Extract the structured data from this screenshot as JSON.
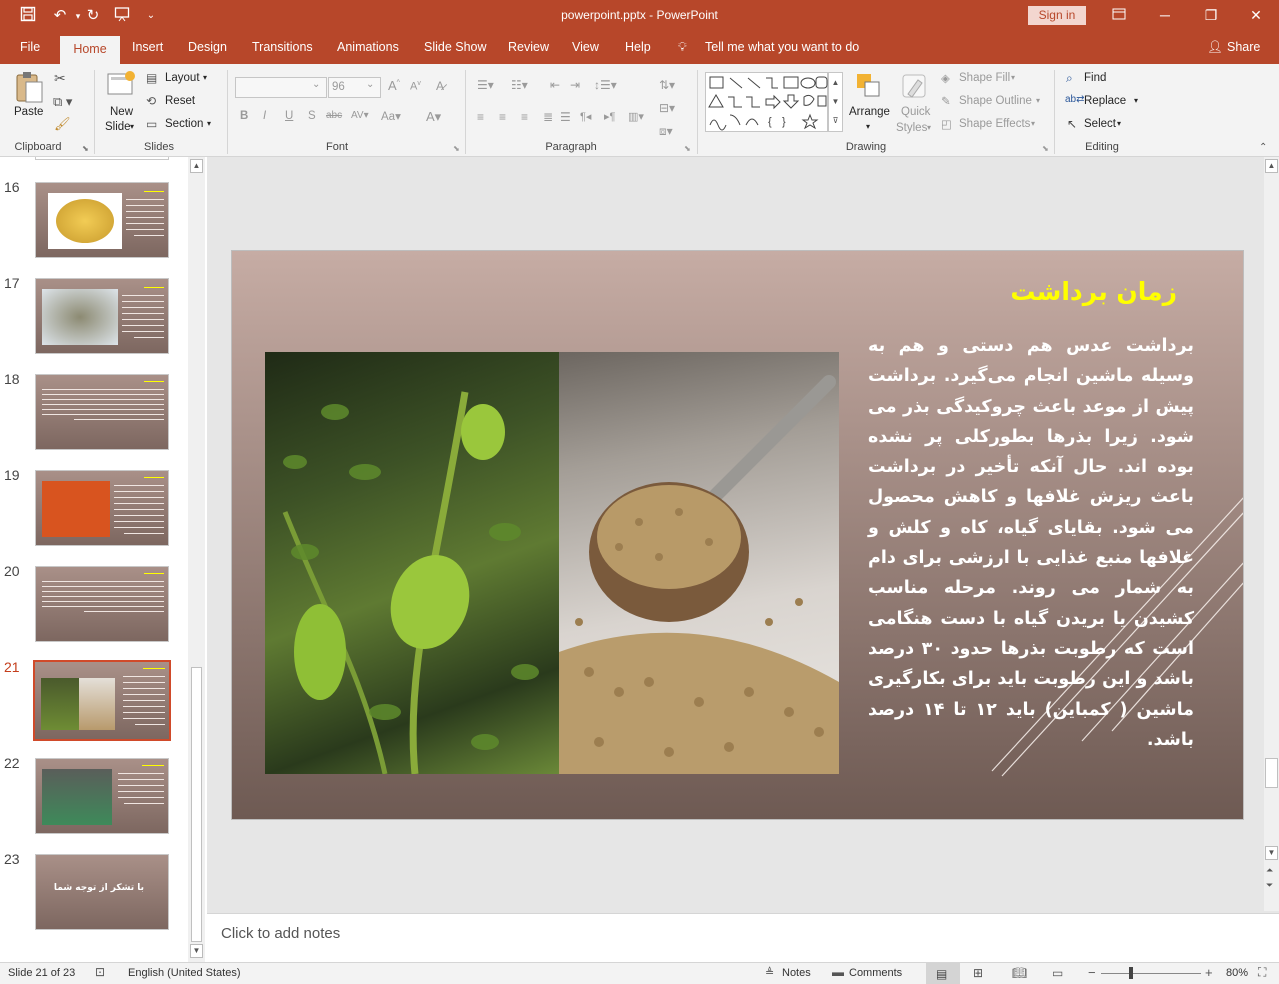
{
  "window": {
    "title": "powerpoint.pptx - PowerPoint",
    "signin": "Sign in"
  },
  "tabs": {
    "file": "File",
    "home": "Home",
    "insert": "Insert",
    "design": "Design",
    "transitions": "Transitions",
    "animations": "Animations",
    "slideshow": "Slide Show",
    "review": "Review",
    "view": "View",
    "help": "Help",
    "tellme": "Tell me what you want to do",
    "share": "Share"
  },
  "ribbon": {
    "clipboard": {
      "label": "Clipboard",
      "paste": "Paste"
    },
    "slides": {
      "label": "Slides",
      "new_slide_1": "New",
      "new_slide_2": "Slide",
      "layout": "Layout",
      "reset": "Reset",
      "section": "Section"
    },
    "font": {
      "label": "Font",
      "size": "96"
    },
    "paragraph": {
      "label": "Paragraph"
    },
    "drawing": {
      "label": "Drawing",
      "arrange": "Arrange",
      "quick_styles_1": "Quick",
      "quick_styles_2": "Styles",
      "shape_fill": "Shape Fill",
      "shape_outline": "Shape Outline",
      "shape_effects": "Shape Effects"
    },
    "editing": {
      "label": "Editing",
      "find": "Find",
      "replace": "Replace",
      "select": "Select"
    }
  },
  "thumbnails": [
    {
      "num": "16"
    },
    {
      "num": "17"
    },
    {
      "num": "18"
    },
    {
      "num": "19"
    },
    {
      "num": "20"
    },
    {
      "num": "21"
    },
    {
      "num": "22"
    },
    {
      "num": "23",
      "text": "با تشکر از توجه شما"
    }
  ],
  "slide": {
    "title": "زمان برداشت",
    "body": "برداشت عدس هم دستی و هم به وسیله ماشین انجام می‌گیرد. برداشت پیش از موعد باعث چروکیدگی بذر می شود. زیرا بذرها بطورکلی پر نشده بوده اند. حال آنکه تأخیر در برداشت باعث ریزش غلافها و کاهش محصول می شود. بقایای گیاه، کاه و کلش و غلافها منبع غذایی با ارزشی برای دام به شمار می روند. مرحله مناسب کشیدن یا بریدن گیاه با دست هنگامی است که رطوبت بذرها حدود ۳۰ درصد باشد و این رطوبت باید برای بکارگیری ماشین ( کمباین) باید ۱۲ تا ۱۴ درصد باشد."
  },
  "notes": {
    "placeholder": "Click to add notes"
  },
  "status": {
    "slide_info": "Slide 21 of 23",
    "language": "English (United States)",
    "notes": "Notes",
    "comments": "Comments",
    "zoom": "80%"
  },
  "colors": {
    "accent": "#b7472a",
    "slide_title": "#ffff00"
  }
}
